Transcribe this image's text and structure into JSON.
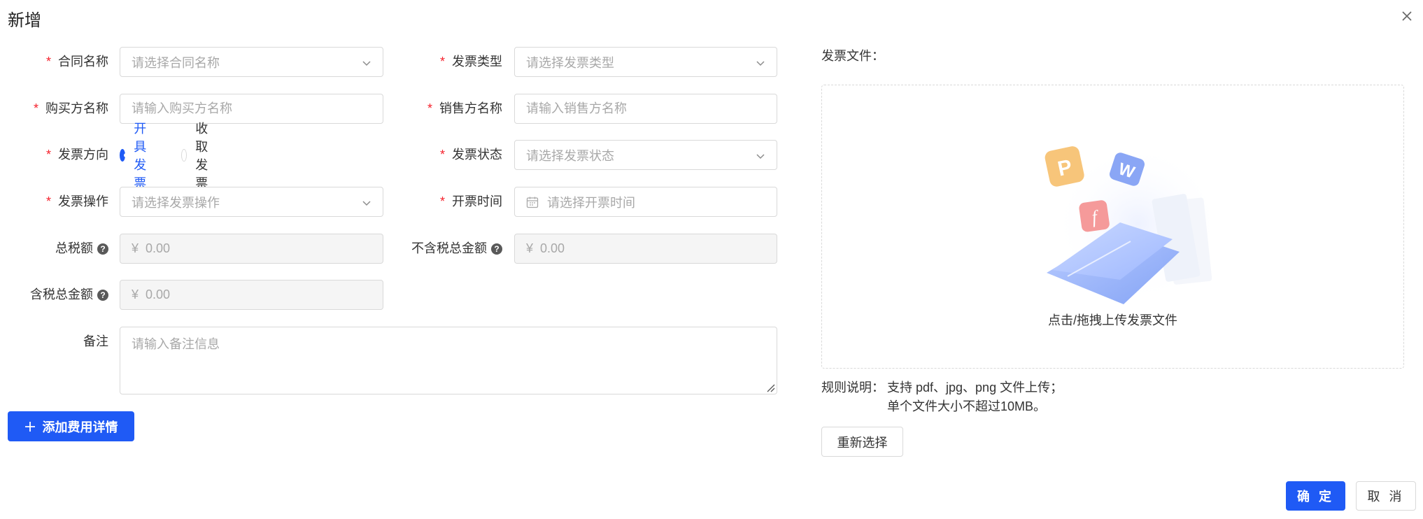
{
  "dialog": {
    "title": "新增"
  },
  "form": {
    "contract_name": {
      "label": "合同名称",
      "placeholder": "请选择合同名称"
    },
    "invoice_type": {
      "label": "发票类型",
      "placeholder": "请选择发票类型"
    },
    "buyer_name": {
      "label": "购买方名称",
      "placeholder": "请输入购买方名称"
    },
    "seller_name": {
      "label": "销售方名称",
      "placeholder": "请输入销售方名称"
    },
    "invoice_direction": {
      "label": "发票方向",
      "options": [
        "开具发票",
        "收取发票"
      ],
      "selected": "开具发票"
    },
    "invoice_status": {
      "label": "发票状态",
      "placeholder": "请选择发票状态"
    },
    "invoice_operation": {
      "label": "发票操作",
      "placeholder": "请选择发票操作"
    },
    "issue_time": {
      "label": "开票时间",
      "placeholder": "请选择开票时间"
    },
    "total_tax": {
      "label": "总税额",
      "currency": "¥",
      "value": "0.00"
    },
    "total_excl_tax": {
      "label": "不含税总金额",
      "currency": "¥",
      "value": "0.00"
    },
    "total_incl_tax": {
      "label": "含税总金额",
      "currency": "¥",
      "value": "0.00"
    },
    "remark": {
      "label": "备注",
      "placeholder": "请输入备注信息"
    },
    "add_fee_button": "添加费用详情"
  },
  "upload": {
    "label": "发票文件：",
    "hint": "点击/拖拽上传发票文件",
    "rule_label": "规则说明：",
    "rule_line1": "支持 pdf、jpg、png 文件上传；",
    "rule_line2": "单个文件大小不超过10MB。",
    "reselect_button": "重新选择",
    "colors": {
      "accent": "#1f5af5",
      "file_orange": "#f7c57a",
      "file_blue": "#8aa6f5",
      "file_red": "#f59a9a"
    }
  },
  "footer": {
    "ok_button": "确 定",
    "cancel_button": "取 消"
  },
  "colors": {
    "primary": "#1f5af5",
    "required": "#f5222d",
    "border": "#d9d9d9",
    "placeholder": "#a8a8a8"
  }
}
